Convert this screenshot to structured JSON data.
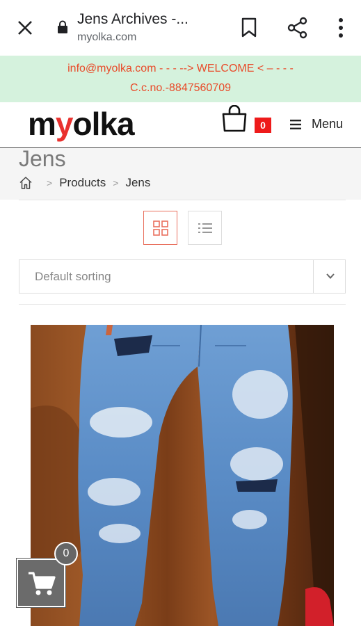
{
  "browser": {
    "tab_title": "Jens Archives -...",
    "url": "myolka.com",
    "icons": [
      "close-icon",
      "lock-icon",
      "bookmark-icon",
      "share-icon",
      "more-vert-icon"
    ]
  },
  "banner": {
    "line1": "info@myolka.com - - - --> WELCOME < – - - -",
    "line2": "C.c.no.-8847560709",
    "background": "#d5f2dd",
    "text_color": "#e94b2a"
  },
  "header": {
    "logo_prefix": "m",
    "logo_accent": "y",
    "logo_suffix": "olka",
    "logo_accent_color": "#e9312e",
    "cart_count": "0",
    "cart_badge_color": "#ee1b1b",
    "menu_label": "Menu"
  },
  "page": {
    "title": "Jens",
    "breadcrumb": {
      "home_icon": "home-icon",
      "items": [
        "Products",
        "Jens"
      ],
      "separator": ">"
    }
  },
  "view_toggle": {
    "options": [
      "grid-view-icon",
      "list-view-icon"
    ],
    "active": "grid-view-icon",
    "active_color": "#e9705e"
  },
  "sorting": {
    "selected": "Default sorting"
  },
  "floating_cart": {
    "count": "0"
  }
}
